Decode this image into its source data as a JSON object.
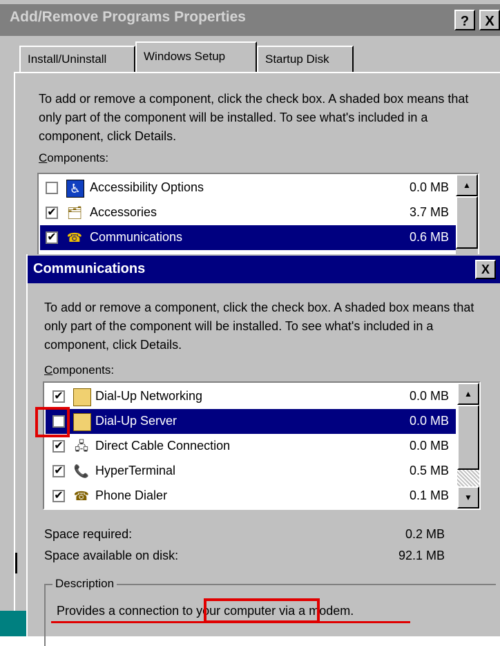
{
  "outer_window": {
    "title": "Add/Remove Programs Properties",
    "help_button": "?",
    "close_button": "X",
    "tabs": [
      {
        "label": "Install/Uninstall"
      },
      {
        "label": "Windows Setup"
      },
      {
        "label": "Startup Disk"
      }
    ],
    "intro": "To add or remove a component, click the check box. A shaded box means that only part of the component will be installed. To see what's included in a component, click Details.",
    "components_label_underlined": "C",
    "components_label_rest": "omponents:",
    "components": [
      {
        "label": "Accessibility Options",
        "size": "0.0 MB",
        "checked": false
      },
      {
        "label": "Accessories",
        "size": "3.7 MB",
        "checked": true
      },
      {
        "label": "Communications",
        "size": "0.6 MB",
        "checked": true,
        "selected": true
      }
    ]
  },
  "dialog": {
    "title": "Communications",
    "close_button": "X",
    "intro": "To add or remove a component, click the check box. A shaded box means that only part of the component will be installed. To see what's included in a component, click Details.",
    "components_label_underlined": "C",
    "components_label_rest": "omponents:",
    "components": [
      {
        "label": "Dial-Up Networking",
        "size": "0.0 MB",
        "checked": true
      },
      {
        "label": "Dial-Up Server",
        "size": "0.0 MB",
        "checked": false,
        "selected": true
      },
      {
        "label": "Direct Cable Connection",
        "size": "0.0 MB",
        "checked": true
      },
      {
        "label": "HyperTerminal",
        "size": "0.5 MB",
        "checked": true
      },
      {
        "label": "Phone Dialer",
        "size": "0.1 MB",
        "checked": true
      }
    ],
    "space_required_label": "Space required:",
    "space_required_value": "0.2 MB",
    "space_available_label": "Space available on disk:",
    "space_available_value": "92.1 MB",
    "description_label": "Description",
    "description_part1": "Provides a connection ",
    "description_part2": "to your computer",
    "description_part3": " via a modem."
  },
  "colors": {
    "face": "#c0c0c0",
    "active_title": "#000080",
    "inactive_title": "#808080",
    "annotation": "#e00000"
  }
}
